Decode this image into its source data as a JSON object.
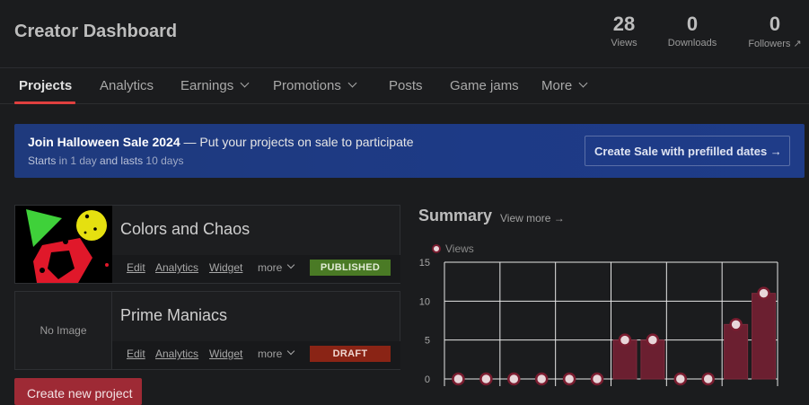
{
  "header": {
    "title": "Creator Dashboard",
    "stats": [
      {
        "value": "28",
        "label": "Views"
      },
      {
        "value": "0",
        "label": "Downloads"
      },
      {
        "value": "0",
        "label": "Followers ↗"
      }
    ]
  },
  "nav": {
    "tabs": [
      {
        "label": "Projects",
        "active": true
      },
      {
        "label": "Analytics"
      },
      {
        "label": "Earnings",
        "dropdown": true
      },
      {
        "label": "Promotions",
        "dropdown": true
      },
      {
        "label": "Posts"
      },
      {
        "label": "Game jams"
      },
      {
        "label": "More",
        "dropdown": true
      }
    ]
  },
  "banner": {
    "title_strong": "Join Halloween Sale 2024",
    "title_rest": " — Put your projects on sale to participate",
    "sub_starts": "Starts",
    "sub_in": " in 1 day ",
    "sub_and": "and lasts ",
    "sub_days": "10 days",
    "button": "Create Sale with prefilled dates →"
  },
  "projects": [
    {
      "title": "Colors and Chaos",
      "status": "PUBLISHED",
      "has_image": true
    },
    {
      "title": "Prime Maniacs",
      "status": "DRAFT",
      "has_image": false,
      "no_image": "No Image"
    }
  ],
  "project_actions": {
    "edit": "Edit",
    "analytics": "Analytics",
    "widget": "Widget",
    "more": "more"
  },
  "create_button": "Create new project",
  "summary": {
    "title": "Summary",
    "view_more": "View more →"
  },
  "colors": {
    "accent": "#e0403f",
    "bar": "#6b1f30",
    "banner": "#1f3a7d"
  },
  "chart_data": {
    "type": "bar",
    "series": [
      {
        "name": "Views",
        "values": [
          0,
          0,
          0,
          0,
          0,
          0,
          5,
          5,
          0,
          0,
          7,
          11
        ]
      }
    ],
    "ylim": [
      0,
      15
    ],
    "yticks": [
      0,
      5,
      10,
      15
    ],
    "grid": true,
    "legend": "top-left"
  }
}
